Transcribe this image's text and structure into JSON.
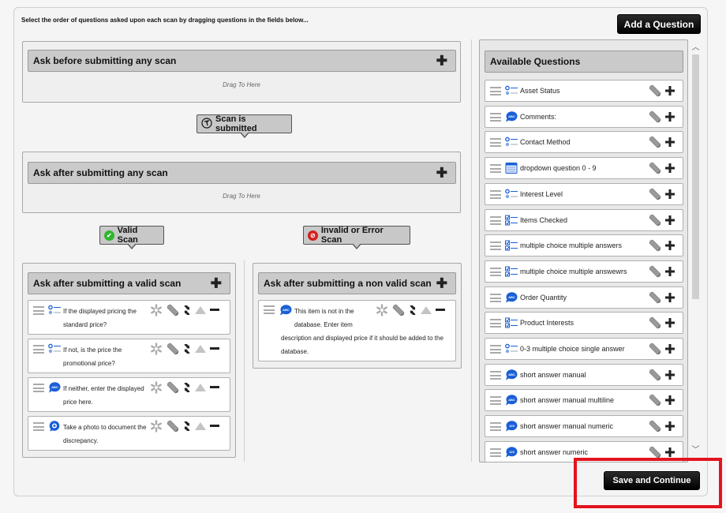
{
  "instructions": "Select the order of questions asked upon each scan by dragging questions in the fields below...",
  "add_question_label": "Add a Question",
  "save_continue_label": "Save and Continue",
  "drag_placeholder": "Drag To Here",
  "zones": {
    "before_any": {
      "title": "Ask before submitting any scan"
    },
    "after_any": {
      "title": "Ask after submitting any scan"
    },
    "valid": {
      "title": "Ask after submitting a valid scan",
      "questions": [
        {
          "type": "single-choice",
          "text": "If the displayed pricing the standard price?"
        },
        {
          "type": "single-choice",
          "text": "If not, is the price the promotional price?"
        },
        {
          "type": "short-answer",
          "text": "If neither, enter the displayed price here."
        },
        {
          "type": "photo",
          "text": "Take a photo to document the discrepancy."
        }
      ]
    },
    "invalid": {
      "title": "Ask after submitting a non valid scan",
      "questions": [
        {
          "type": "short-answer",
          "text_line1": "This item is not in the",
          "text_line2": "database. Enter item",
          "text_rest": "description and displayed price if it should be added to the database."
        }
      ]
    }
  },
  "tooltips": {
    "scan_submitted": "Scan is submitted",
    "valid_scan": "Valid Scan",
    "invalid_scan": "Invalid or Error Scan"
  },
  "available": {
    "title": "Available Questions",
    "items": [
      {
        "type": "single-choice",
        "label": "Asset Status"
      },
      {
        "type": "short-answer",
        "label": "Comments:"
      },
      {
        "type": "single-choice",
        "label": "Contact Method"
      },
      {
        "type": "dropdown",
        "label": "dropdown question 0 - 9"
      },
      {
        "type": "single-choice",
        "label": "Interest Level"
      },
      {
        "type": "multi-choice",
        "label": "Items Checked"
      },
      {
        "type": "multi-choice",
        "label": "multiple choice multiple answers"
      },
      {
        "type": "multi-choice",
        "label": "multiple choice multiple answewrs"
      },
      {
        "type": "short-answer",
        "label": "Order Quantity"
      },
      {
        "type": "multi-choice",
        "label": "Product Interests"
      },
      {
        "type": "single-choice",
        "label": "0-3 multiple choice single answer"
      },
      {
        "type": "short-answer",
        "label": "short answer manual"
      },
      {
        "type": "multiline",
        "label": "short answer manual multiline"
      },
      {
        "type": "numeric",
        "label": "short answer manual numeric"
      },
      {
        "type": "numeric",
        "label": "short answer numeric"
      }
    ]
  },
  "colors": {
    "accent_red_highlight": "#e3141e",
    "valid_green": "#2fb52f",
    "invalid_red": "#d42020",
    "question_icon_blue": "#1a5fd6"
  }
}
